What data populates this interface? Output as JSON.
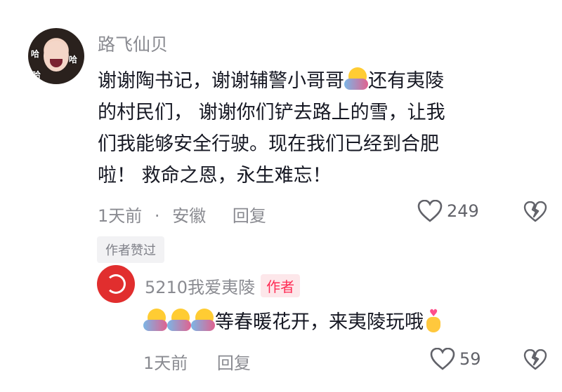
{
  "comment": {
    "author": "路飞仙贝",
    "avatar_badge": "哈",
    "text_part1": "谢谢陶书记，谢谢辅警小哥哥",
    "text_part2": "还有夷陵",
    "text_part3": "的村民们，  谢谢你们铲去路上的雪，让我",
    "text_part4": "们我能够安全行驶。现在我们已经到合肥",
    "text_part5": "啦！  救命之恩，永生难忘！",
    "time": "1天前",
    "separator": "·",
    "location": "安徽",
    "reply_label": "回复",
    "like_count": "249",
    "liked_by_author": "作者赞过",
    "icons": [
      "heart-outline-icon",
      "dislike-broken-heart-icon",
      "hug-emoji"
    ]
  },
  "reply": {
    "author": "5210我爱夷陵",
    "author_tag": "作者",
    "text": "等春暖花开，来夷陵玩哦",
    "time": "1天前",
    "reply_label": "回复",
    "like_count": "59",
    "icons": [
      "hug-emoji",
      "finger-heart-emoji",
      "heart-outline-icon",
      "dislike-broken-heart-icon"
    ]
  },
  "colors": {
    "accent": "#fe2c55",
    "meta_gray": "#8a8b91",
    "text": "#161823"
  }
}
